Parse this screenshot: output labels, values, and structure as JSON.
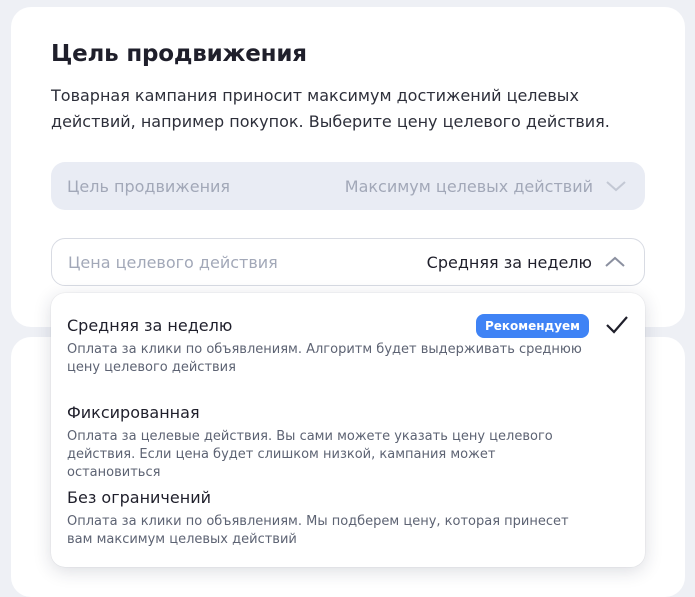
{
  "section": {
    "title": "Цель продвижения",
    "description": "Товарная кампания приносит максимум достижений целевых действий, например покупок. Выберите цену целевого действия."
  },
  "goal_select": {
    "label": "Цель продвижения",
    "value": "Максимум целевых действий"
  },
  "price_select": {
    "label": "Цена целевого действия",
    "value": "Средняя за неделю"
  },
  "dropdown": {
    "options": [
      {
        "title": "Средняя за неделю",
        "description": "Оплата за клики по объявлениям. Алгоритм будет выдерживать среднюю цену целевого действия",
        "badge": "Рекомендуем",
        "selected": true
      },
      {
        "title": "Фиксированная",
        "description": "Оплата за целевые действия. Вы сами можете указать цену целевого действия. Если цена будет слишком низкой, кампания может остановиться"
      },
      {
        "title": "Без ограничений",
        "description": "Оплата за клики по объявлениям. Мы подберем цену, которая принесет вам максимум целевых действий"
      }
    ]
  },
  "colors": {
    "accent": "#3f83f5",
    "background": "#eef0f5",
    "disabled_field": "#e9ecf4"
  }
}
